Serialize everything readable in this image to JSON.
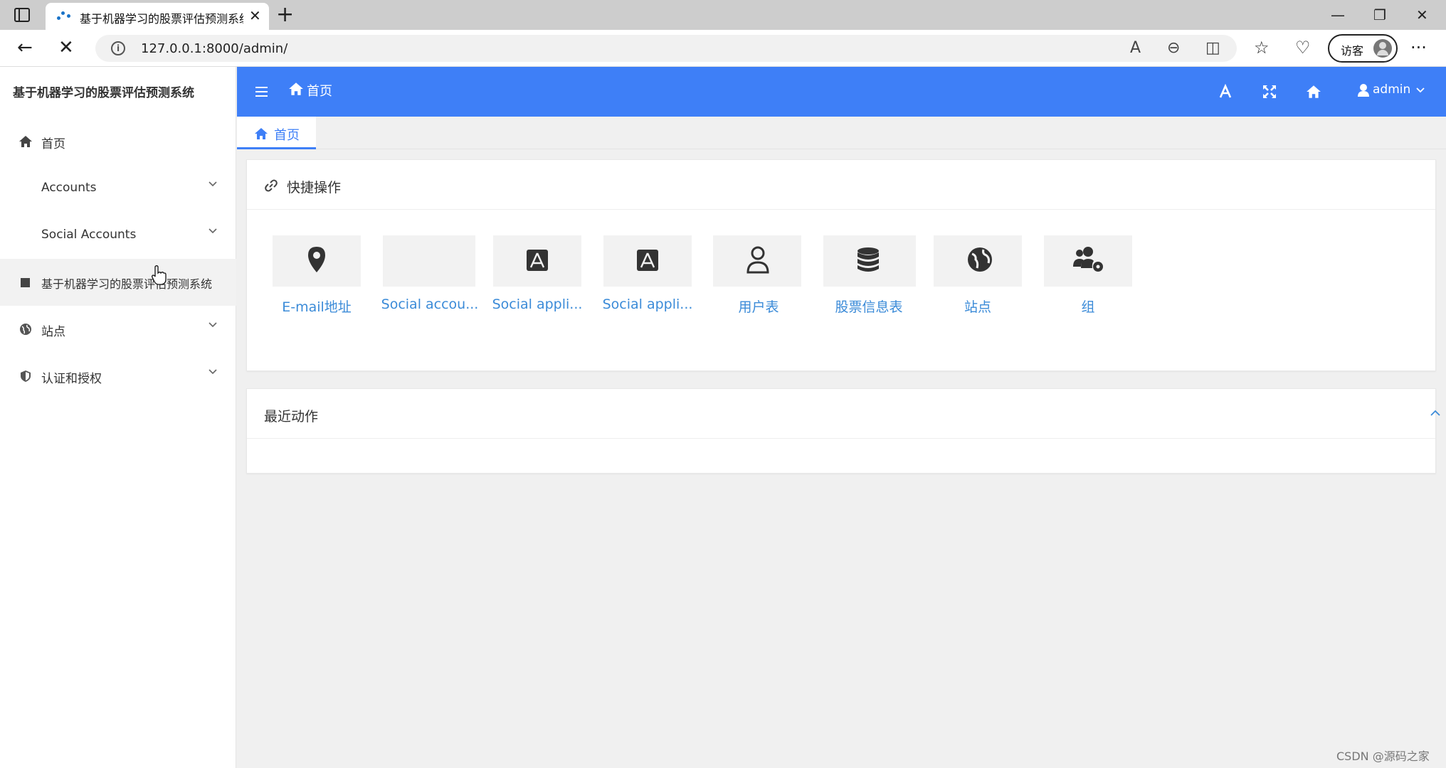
{
  "browser": {
    "tab_title": "基于机器学习的股票评估预测系统",
    "url": "127.0.0.1:8000/admin/",
    "guest_label": "访客"
  },
  "sidebar": {
    "title": "基于机器学习的股票评估预测系统",
    "items": [
      {
        "label": "首页",
        "icon": "home-icon"
      },
      {
        "label": "Accounts",
        "icon": ""
      },
      {
        "label": "Social Accounts",
        "icon": ""
      },
      {
        "label": "基于机器学习的股票评估预测系统",
        "icon": "square-icon"
      },
      {
        "label": "站点",
        "icon": "globe-icon"
      },
      {
        "label": "认证和授权",
        "icon": "shield-icon"
      }
    ]
  },
  "header": {
    "home_label": "首页",
    "user_label": "admin",
    "accent_color": "#3e7ff7"
  },
  "tabs": [
    {
      "label": "首页"
    }
  ],
  "quick_actions": {
    "title": "快捷操作",
    "items": [
      {
        "label": "E-mail地址",
        "icon": "map-marker-icon"
      },
      {
        "label": "Social accou...",
        "icon": ""
      },
      {
        "label": "Social appli...",
        "icon": "app-store-icon"
      },
      {
        "label": "Social appli...",
        "icon": "app-store-icon"
      },
      {
        "label": "用户表",
        "icon": "user-icon"
      },
      {
        "label": "股票信息表",
        "icon": "database-icon"
      },
      {
        "label": "站点",
        "icon": "globe-icon"
      },
      {
        "label": "组",
        "icon": "users-cog-icon"
      }
    ]
  },
  "recent_actions": {
    "title": "最近动作"
  },
  "watermark": "CSDN @源码之家"
}
